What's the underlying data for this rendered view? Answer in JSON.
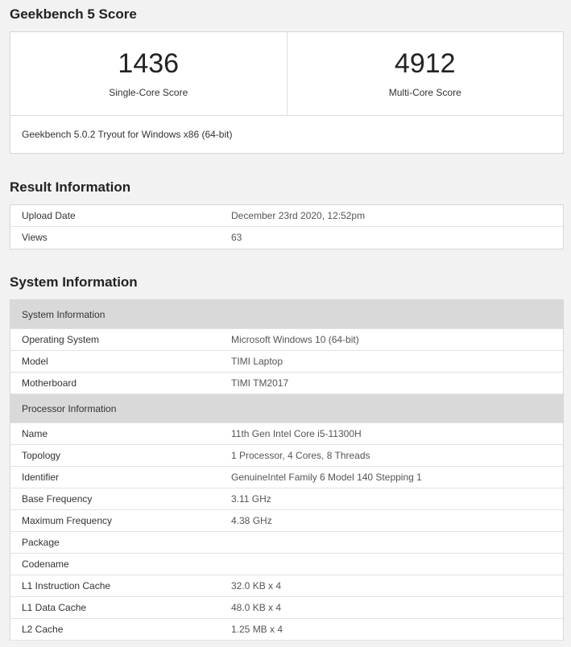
{
  "score_section": {
    "title": "Geekbench 5 Score",
    "single": {
      "value": "1436",
      "label": "Single-Core Score"
    },
    "multi": {
      "value": "4912",
      "label": "Multi-Core Score"
    },
    "footer": "Geekbench 5.0.2 Tryout for Windows x86 (64-bit)"
  },
  "result_section": {
    "title": "Result Information",
    "rows": [
      {
        "key": "Upload Date",
        "value": "December 23rd 2020, 12:52pm"
      },
      {
        "key": "Views",
        "value": "63"
      }
    ]
  },
  "system_section": {
    "title": "System Information",
    "groups": [
      {
        "header": "System Information",
        "rows": [
          {
            "key": "Operating System",
            "value": "Microsoft Windows 10 (64-bit)"
          },
          {
            "key": "Model",
            "value": "TIMI Laptop"
          },
          {
            "key": "Motherboard",
            "value": "TIMI TM2017"
          }
        ]
      },
      {
        "header": "Processor Information",
        "rows": [
          {
            "key": "Name",
            "value": "11th Gen Intel Core i5-11300H"
          },
          {
            "key": "Topology",
            "value": "1 Processor, 4 Cores, 8 Threads"
          },
          {
            "key": "Identifier",
            "value": "GenuineIntel Family 6 Model 140 Stepping 1"
          },
          {
            "key": "Base Frequency",
            "value": "3.11 GHz"
          },
          {
            "key": "Maximum Frequency",
            "value": "4.38 GHz"
          },
          {
            "key": "Package",
            "value": ""
          },
          {
            "key": "Codename",
            "value": ""
          },
          {
            "key": "L1 Instruction Cache",
            "value": "32.0 KB x 4"
          },
          {
            "key": "L1 Data Cache",
            "value": "48.0 KB x 4"
          },
          {
            "key": "L2 Cache",
            "value": "1.25 MB x 4"
          }
        ]
      }
    ]
  }
}
